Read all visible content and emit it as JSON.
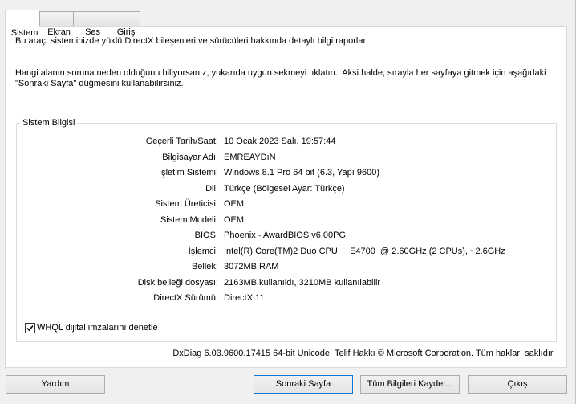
{
  "tabs": [
    {
      "label": "Sistem",
      "selected": true
    },
    {
      "label": "Ekran",
      "selected": false
    },
    {
      "label": "Ses",
      "selected": false
    },
    {
      "label": "Giriş",
      "selected": false
    }
  ],
  "intro": {
    "line1": "Bu araç, sisteminizde yüklü DirectX bileşenleri ve sürücüleri hakkında detaylı bilgi raporlar.",
    "line2": "Hangi alanın soruna neden olduğunu biliyorsanız, yukarıda uygun sekmeyi tıklatın.  Aksi halde, sırayla her sayfaya gitmek için aşağıdaki",
    "line3": "\"Sonraki Sayfa\" düğmesini kullanabilirsiniz."
  },
  "system_info": {
    "title": "Sistem Bilgisi",
    "rows": [
      {
        "label": "Geçerli Tarih/Saat:",
        "value": "10 Ocak 2023 Salı, 19:57:44"
      },
      {
        "label": "Bilgisayar Adı:",
        "value": "EMREAYDıN"
      },
      {
        "label": "İşletim Sistemi:",
        "value": "Windows 8.1 Pro 64 bit (6.3, Yapı 9600)"
      },
      {
        "label": "Dil:",
        "value": "Türkçe (Bölgesel Ayar: Türkçe)"
      },
      {
        "label": "Sistem Üreticisi:",
        "value": "OEM"
      },
      {
        "label": "Sistem Modeli:",
        "value": "OEM"
      },
      {
        "label": "BIOS:",
        "value": "Phoenix - AwardBIOS v6.00PG"
      },
      {
        "label": "İşlemci:",
        "value": "Intel(R) Core(TM)2 Duo CPU     E4700  @ 2.60GHz (2 CPUs), ~2.6GHz"
      },
      {
        "label": "Bellek:",
        "value": "3072MB RAM"
      },
      {
        "label": "Disk belleği dosyası:",
        "value": "2163MB kullanıldı, 3210MB kullanılabilir"
      },
      {
        "label": "DirectX Sürümü:",
        "value": "DirectX 11"
      }
    ]
  },
  "whql": {
    "label": "WHQL dijital imzalarını denetle",
    "checked": true,
    "icon": "check-icon"
  },
  "footer": "DxDiag 6.03.9600.17415 64-bit Unicode  Telif Hakkı © Microsoft Corporation. Tüm hakları saklıdır.",
  "buttons": {
    "help": "Yardım",
    "next": "Sonraki Sayfa",
    "save": "Tüm Bilgileri Kaydet...",
    "exit": "Çıkış"
  },
  "colors": {
    "default_button_border": "#0078d7",
    "panel_background": "#ffffff",
    "window_background": "#f0f0f0"
  }
}
